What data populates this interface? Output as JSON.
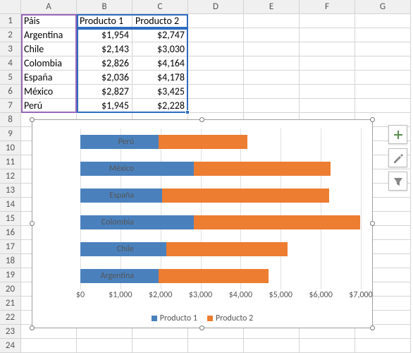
{
  "columns": [
    "A",
    "B",
    "C",
    "D",
    "E",
    "F",
    "G"
  ],
  "rows_count": 24,
  "table": {
    "header": {
      "A": "Páis",
      "B": "Producto 1",
      "C": "Producto 2"
    },
    "data": [
      {
        "A": "Argentina",
        "B": "$1,954",
        "C": "$2,747"
      },
      {
        "A": "Chile",
        "B": "$2,143",
        "C": "$3,030"
      },
      {
        "A": "Colombia",
        "B": "$2,826",
        "C": "$4,164"
      },
      {
        "A": "España",
        "B": "$2,036",
        "C": "$4,178"
      },
      {
        "A": "México",
        "B": "$2,827",
        "C": "$3,425"
      },
      {
        "A": "Perú",
        "B": "$1,945",
        "C": "$2,228"
      }
    ]
  },
  "chart_data": {
    "type": "bar",
    "orientation": "horizontal",
    "stacked": true,
    "categories": [
      "Perú",
      "México",
      "España",
      "Colombia",
      "Chile",
      "Argentina"
    ],
    "series": [
      {
        "name": "Producto 1",
        "color": "#4a81bd",
        "values": [
          1945,
          2827,
          2036,
          2826,
          2143,
          1954
        ]
      },
      {
        "name": "Producto 2",
        "color": "#ed7d31",
        "values": [
          2228,
          3425,
          4178,
          4164,
          3030,
          2747
        ]
      }
    ],
    "xlim": [
      0,
      7000
    ],
    "xticks": [
      "$0",
      "$1,000",
      "$2,000",
      "$3,000",
      "$4,000",
      "$5,000",
      "$6,000",
      "$7,000"
    ],
    "xlabel": "",
    "ylabel": ""
  },
  "side_buttons": {
    "add": "+",
    "style": "",
    "filter": ""
  }
}
